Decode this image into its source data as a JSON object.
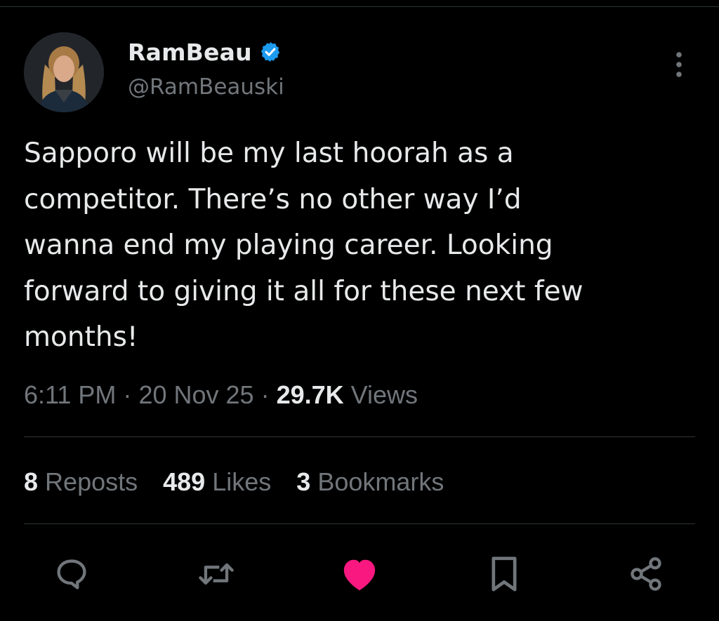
{
  "author": {
    "display_name": "RamBeau",
    "handle": "@RamBeauski",
    "verified": true,
    "avatar_icon": "profile-photo"
  },
  "tweet": {
    "text": "Sapporo will be my last hoorah as a\ncompetitor. There’s no other way I’d\nwanna end my playing career. Looking\nforward to giving it all for these next few\nmonths!",
    "time": "6:11 PM",
    "date": "20 Nov 25",
    "separator": "·",
    "views_count": "29.7K",
    "views_label": "Views"
  },
  "stats": {
    "reposts_count": "8",
    "reposts_label": "Reposts",
    "likes_count": "489",
    "likes_label": "Likes",
    "bookmarks_count": "3",
    "bookmarks_label": "Bookmarks"
  },
  "actions": {
    "reply_icon": "speech-bubble-icon",
    "repost_icon": "repost-arrows-icon",
    "like_icon": "heart-icon",
    "bookmark_icon": "bookmark-icon",
    "share_icon": "share-nodes-icon"
  },
  "colors": {
    "background": "#000000",
    "text_primary": "#e7e9ea",
    "text_secondary": "#71767b",
    "verified_blue": "#1d9bf0",
    "like_pink": "#f91880",
    "divider": "#2f3336"
  }
}
